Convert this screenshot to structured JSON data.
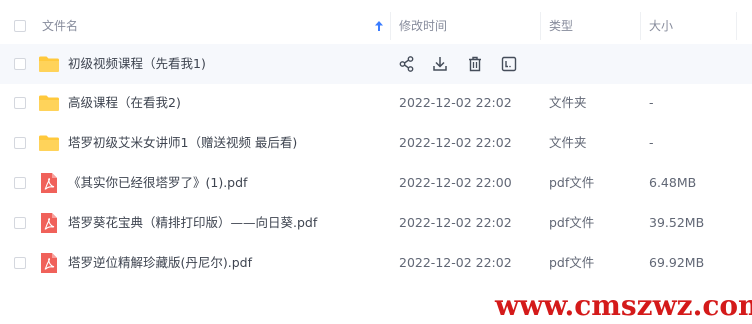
{
  "header": {
    "name": "文件名",
    "modified": "修改时间",
    "type": "类型",
    "size": "大小"
  },
  "rows": [
    {
      "name": "初级视频课程（先看我1)",
      "modified": "",
      "type": "",
      "size": "",
      "icon": "folder-icon"
    },
    {
      "name": "高级课程（在看我2)",
      "modified": "2022-12-02 22:02",
      "type": "文件夹",
      "size": "-",
      "icon": "folder-icon"
    },
    {
      "name": "塔罗初级艾米女讲师1（赠送视频 最后看)",
      "modified": "2022-12-02 22:02",
      "type": "文件夹",
      "size": "-",
      "icon": "folder-icon"
    },
    {
      "name": "《其实你已经很塔罗了》(1).pdf",
      "modified": "2022-12-02 22:00",
      "type": "pdf文件",
      "size": "6.48MB",
      "icon": "pdf-icon"
    },
    {
      "name": "塔罗葵花宝典（精排打印版）——向日葵.pdf",
      "modified": "2022-12-02 22:02",
      "type": "pdf文件",
      "size": "39.52MB",
      "icon": "pdf-icon"
    },
    {
      "name": "塔罗逆位精解珍藏版(丹尼尔).pdf",
      "modified": "2022-12-02 22:02",
      "type": "pdf文件",
      "size": "69.92MB",
      "icon": "pdf-icon"
    }
  ],
  "hover_actions": [
    "share-icon",
    "download-icon",
    "delete-icon",
    "more-icon"
  ],
  "watermark": "www.cmszwz.com",
  "colors": {
    "folder": "#ffc93c",
    "pdf": "#f0615a",
    "hover_row": "#f6f8fc",
    "sort_arrow": "#3a7cff",
    "watermark": "#d41a1a"
  }
}
